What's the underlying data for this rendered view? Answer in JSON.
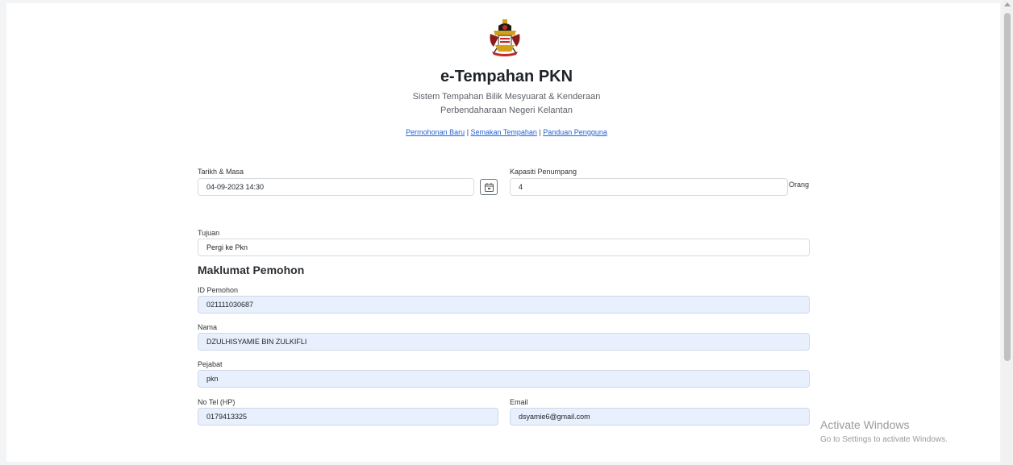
{
  "header": {
    "logo": "state-crest-icon",
    "title": "e-Tempahan PKN",
    "subtitle_line1": "Sistem Tempahan Bilik Mesyuarat & Kenderaan",
    "subtitle_line2": "Perbendaharaan Negeri Kelantan"
  },
  "nav": {
    "link1": "Permohonan Baru",
    "sep1": " | ",
    "link2": "Semakan Tempahan",
    "sep2": " | ",
    "link3": "Panduan Pengguna"
  },
  "form": {
    "datetime_label": "Tarikh & Masa",
    "datetime_value": "04-09-2023 14:30",
    "calendar_icon": "calendar-icon",
    "capacity_label": "Kapasiti Penumpang",
    "capacity_value": "4",
    "capacity_unit": "Orang",
    "destination_label": "Tujuan",
    "destination_value": "Pergi ke Pkn"
  },
  "applicant": {
    "section_title": "Maklumat Pemohon",
    "id_label": "ID Pemohon",
    "id_value": "021111030687",
    "name_label": "Nama",
    "name_value": "DZULHISYAMIE BIN ZULKIFLI",
    "office_label": "Pejabat",
    "office_value": "pkn",
    "phone_label": "No Tel (HP)",
    "phone_value": "0179413325",
    "email_label": "Email",
    "email_value": "dsyamie6@gmail.com"
  },
  "watermark": {
    "title": "Activate Windows",
    "subtitle": "Go to Settings to activate Windows."
  },
  "colors": {
    "link": "#2463d6",
    "readonly_bg": "#e8f0fe"
  }
}
